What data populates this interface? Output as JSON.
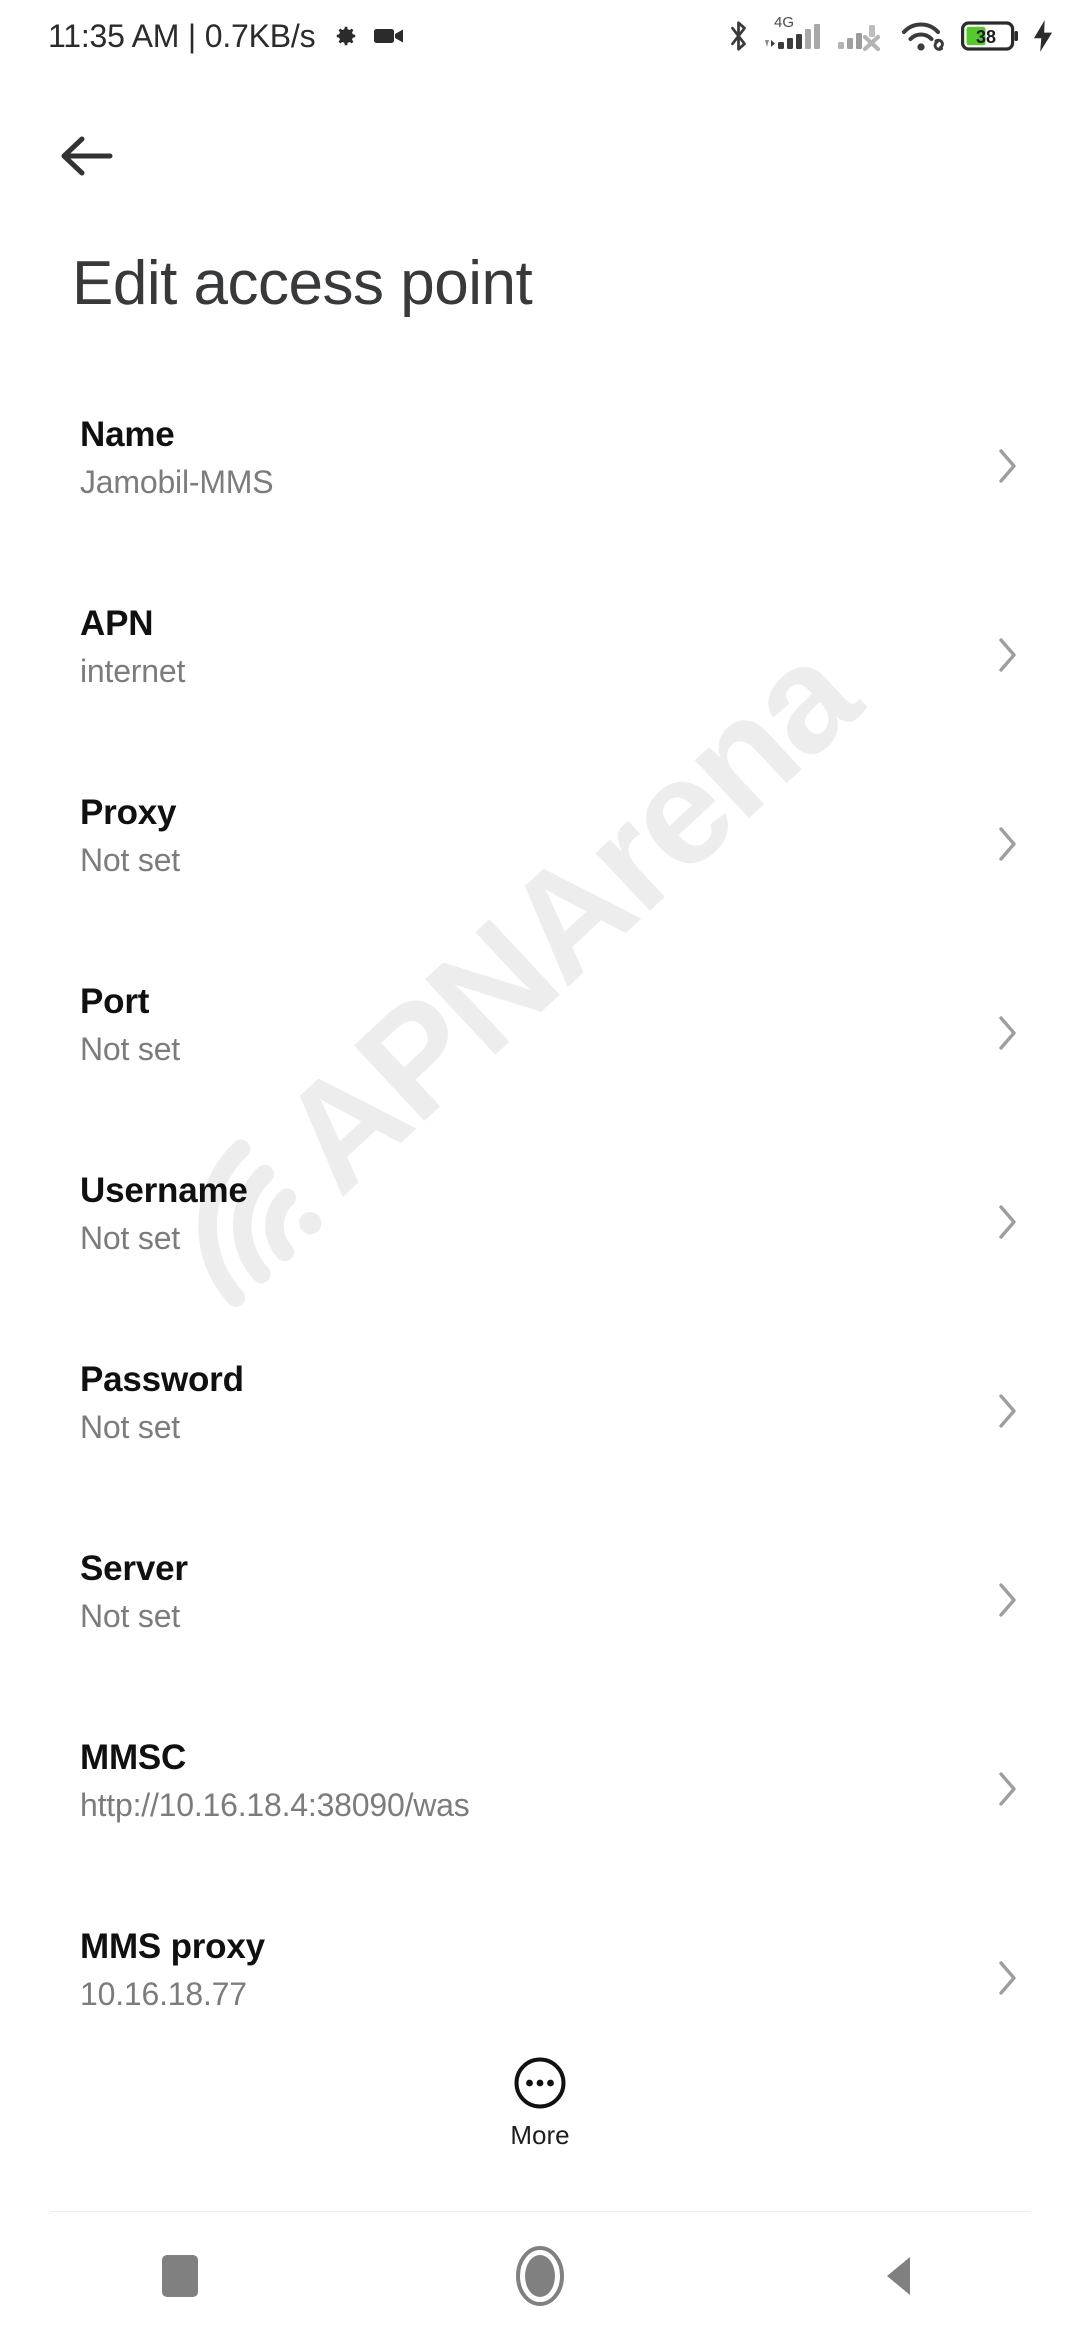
{
  "status_bar": {
    "clock": "11:35 AM | 0.7KB/s",
    "network_label": "4G",
    "battery_level": "38",
    "icons": [
      "gear-icon",
      "video-camera-icon",
      "bluetooth-icon",
      "signal-4g-icon",
      "signal-sim2-off-icon",
      "wifi-link-icon",
      "battery-icon",
      "charging-bolt-icon"
    ],
    "battery_color": "#55c92f",
    "text_color": "#2b2b2b"
  },
  "header": {
    "back_icon": "arrow-left-icon",
    "title": "Edit access point"
  },
  "watermark": {
    "text": "APNArena",
    "color": "#ededed"
  },
  "settings": {
    "chevron_icon": "chevron-right-icon",
    "rows": [
      {
        "title": "Name",
        "value": "Jamobil-MMS"
      },
      {
        "title": "APN",
        "value": "internet"
      },
      {
        "title": "Proxy",
        "value": "Not set"
      },
      {
        "title": "Port",
        "value": "Not set"
      },
      {
        "title": "Username",
        "value": "Not set"
      },
      {
        "title": "Password",
        "value": "Not set"
      },
      {
        "title": "Server",
        "value": "Not set"
      },
      {
        "title": "MMSC",
        "value": "http://10.16.18.4:38090/was"
      },
      {
        "title": "MMS proxy",
        "value": "10.16.18.77"
      }
    ]
  },
  "more_button": {
    "label": "More",
    "icon": "more-circle-icon"
  },
  "nav_bar": {
    "recents_label": "recents-button",
    "home_label": "home-button",
    "back_label": "back-button",
    "color": "#808080"
  }
}
